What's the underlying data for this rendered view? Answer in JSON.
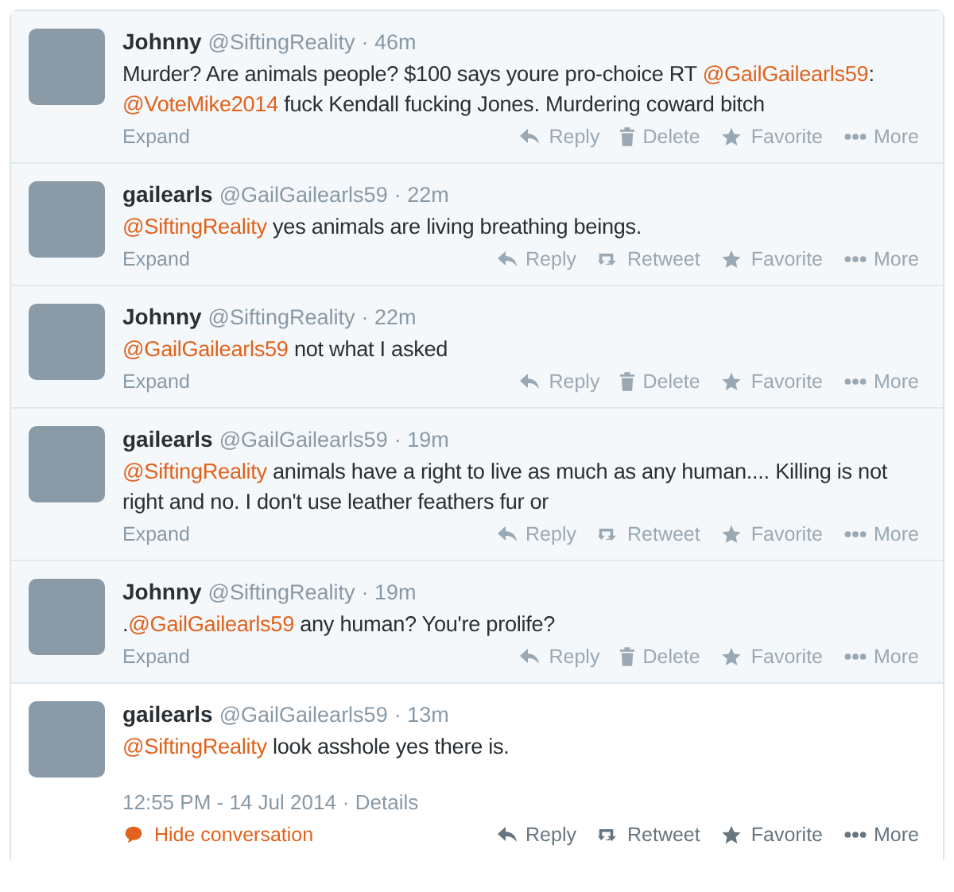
{
  "tweets": [
    {
      "name": "Johnny",
      "handle": "@SiftingReality",
      "time": "· 46m",
      "focused": false,
      "text": [
        {
          "kind": "text",
          "t": "Murder? Are animals people? $100 says youre pro-choice RT "
        },
        {
          "kind": "mention",
          "t": "@GailGailearls59"
        },
        {
          "kind": "text",
          "t": ": "
        },
        {
          "kind": "mention",
          "t": "@VoteMike2014"
        },
        {
          "kind": "text",
          "t": " fuck Kendall fucking Jones. Murdering coward bitch"
        }
      ],
      "expand": "Expand",
      "actions": [
        {
          "kind": "reply",
          "label": "Reply"
        },
        {
          "kind": "delete",
          "label": "Delete"
        },
        {
          "kind": "favorite",
          "label": "Favorite"
        },
        {
          "kind": "more",
          "label": "More"
        }
      ]
    },
    {
      "name": "gailearls",
      "handle": "@GailGailearls59",
      "time": "· 22m",
      "focused": false,
      "text": [
        {
          "kind": "mention",
          "t": "@SiftingReality"
        },
        {
          "kind": "text",
          "t": " yes animals are living breathing beings."
        }
      ],
      "expand": "Expand",
      "actions": [
        {
          "kind": "reply",
          "label": "Reply"
        },
        {
          "kind": "retweet",
          "label": "Retweet"
        },
        {
          "kind": "favorite",
          "label": "Favorite"
        },
        {
          "kind": "more",
          "label": "More"
        }
      ]
    },
    {
      "name": "Johnny",
      "handle": "@SiftingReality",
      "time": "· 22m",
      "focused": false,
      "text": [
        {
          "kind": "mention",
          "t": "@GailGailearls59"
        },
        {
          "kind": "text",
          "t": " not what I asked"
        }
      ],
      "expand": "Expand",
      "actions": [
        {
          "kind": "reply",
          "label": "Reply"
        },
        {
          "kind": "delete",
          "label": "Delete"
        },
        {
          "kind": "favorite",
          "label": "Favorite"
        },
        {
          "kind": "more",
          "label": "More"
        }
      ]
    },
    {
      "name": "gailearls",
      "handle": "@GailGailearls59",
      "time": "· 19m",
      "focused": false,
      "text": [
        {
          "kind": "mention",
          "t": "@SiftingReality"
        },
        {
          "kind": "text",
          "t": " animals have a right to live as much as any human....  Killing is not right and no. I don't use leather feathers fur or"
        }
      ],
      "expand": "Expand",
      "actions": [
        {
          "kind": "reply",
          "label": "Reply"
        },
        {
          "kind": "retweet",
          "label": "Retweet"
        },
        {
          "kind": "favorite",
          "label": "Favorite"
        },
        {
          "kind": "more",
          "label": "More"
        }
      ]
    },
    {
      "name": "Johnny",
      "handle": "@SiftingReality",
      "time": "· 19m",
      "focused": false,
      "text": [
        {
          "kind": "text",
          "t": "."
        },
        {
          "kind": "mention",
          "t": "@GailGailearls59"
        },
        {
          "kind": "text",
          "t": " any human? You're prolife?"
        }
      ],
      "expand": "Expand",
      "actions": [
        {
          "kind": "reply",
          "label": "Reply"
        },
        {
          "kind": "delete",
          "label": "Delete"
        },
        {
          "kind": "favorite",
          "label": "Favorite"
        },
        {
          "kind": "more",
          "label": "More"
        }
      ]
    },
    {
      "name": "gailearls",
      "handle": "@GailGailearls59",
      "time": "· 13m",
      "focused": true,
      "text": [
        {
          "kind": "mention",
          "t": "@SiftingReality"
        },
        {
          "kind": "text",
          "t": " look asshole yes there is."
        }
      ],
      "timestamp": "12:55 PM - 14 Jul 2014",
      "details": "· Details",
      "hide_conversation": "Hide conversation",
      "actions": [
        {
          "kind": "reply",
          "label": "Reply"
        },
        {
          "kind": "retweet",
          "label": "Retweet"
        },
        {
          "kind": "favorite",
          "label": "Favorite"
        },
        {
          "kind": "more",
          "label": "More"
        }
      ]
    }
  ]
}
